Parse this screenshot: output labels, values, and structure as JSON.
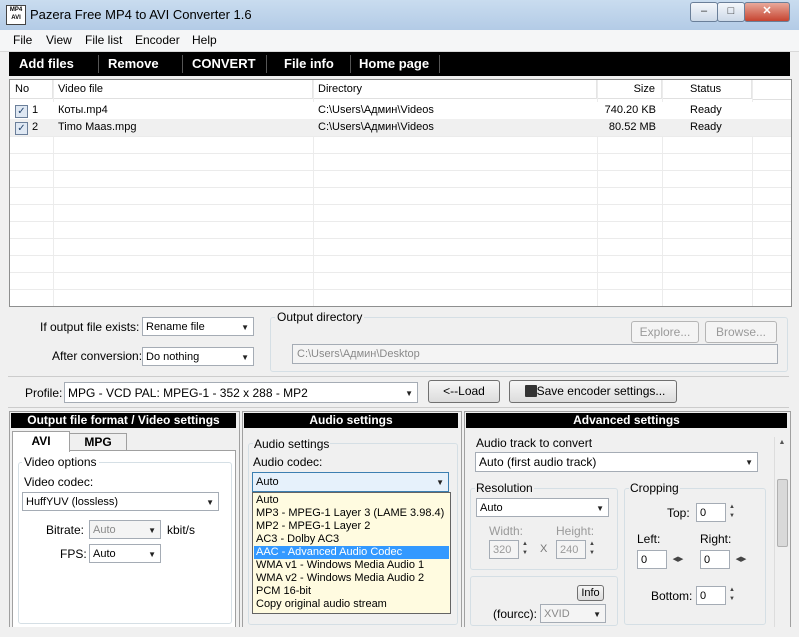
{
  "window": {
    "title": "Pazera Free MP4 to AVI Converter 1.6",
    "icon_text": "MP4 AVI",
    "controls": {
      "minimize": "–",
      "maximize": "□",
      "close": "✕"
    }
  },
  "menu": [
    "File",
    "View",
    "File list",
    "Encoder",
    "Help"
  ],
  "toolbar": [
    "Add files",
    "Remove",
    "CONVERT",
    "File info",
    "Home page"
  ],
  "file_table": {
    "columns": [
      "No",
      "Video file",
      "Directory",
      "Size",
      "Status"
    ],
    "rows": [
      {
        "checked": true,
        "no": "1",
        "file": "Коты.mp4",
        "dir": "C:\\Users\\Админ\\Videos",
        "size": "740.20 KB",
        "status": "Ready"
      },
      {
        "checked": true,
        "no": "2",
        "file": "Timo Maas.mpg",
        "dir": "C:\\Users\\Админ\\Videos",
        "size": "80.52 MB",
        "status": "Ready"
      }
    ]
  },
  "output": {
    "if_exists_label": "If output file exists:",
    "if_exists_value": "Rename file",
    "after_label": "After conversion:",
    "after_value": "Do nothing",
    "dir_group": "Output directory",
    "dir_value": "C:\\Users\\Админ\\Desktop",
    "explore": "Explore...",
    "browse": "Browse..."
  },
  "profile": {
    "label": "Profile:",
    "value": "MPG - VCD PAL: MPEG-1 - 352 x 288 - MP2",
    "load": "<--Load",
    "save": "Save encoder settings..."
  },
  "video_panel": {
    "header": "Output file format / Video settings",
    "tabs": [
      "AVI",
      "MPG"
    ],
    "group": "Video options",
    "codec_label": "Video codec:",
    "codec_value": "HuffYUV (lossless)",
    "bitrate_label": "Bitrate:",
    "bitrate_value": "Auto",
    "bitrate_unit": "kbit/s",
    "fps_label": "FPS:",
    "fps_value": "Auto"
  },
  "audio_panel": {
    "header": "Audio settings",
    "group": "Audio settings",
    "codec_label": "Audio codec:",
    "codec_value": "Auto",
    "options": [
      "Auto",
      "MP3 - MPEG-1 Layer 3 (LAME 3.98.4)",
      "MP2 - MPEG-1 Layer 2",
      "AC3 - Dolby AC3",
      "AAC - Advanced Audio Codec",
      "WMA v1 - Windows Media Audio 1",
      "WMA v2 - Windows Media Audio 2",
      "PCM 16-bit",
      "Copy original audio stream"
    ],
    "highlighted_index": 4
  },
  "advanced_panel": {
    "header": "Advanced settings",
    "track_label": "Audio track to convert",
    "track_value": "Auto (first audio track)",
    "resolution_group": "Resolution",
    "resolution_value": "Auto",
    "width_label": "Width:",
    "width_value": "320",
    "height_label": "Height:",
    "height_value": "240",
    "x_sep": "X",
    "cropping_group": "Cropping",
    "top_label": "Top:",
    "top_value": "0",
    "left_label": "Left:",
    "left_value": "0",
    "right_label": "Right:",
    "right_value": "0",
    "bottom_label": "Bottom:",
    "bottom_value": "0",
    "info_button": "Info",
    "fourcc_label": "(fourcc):",
    "fourcc_value": "XVID"
  },
  "colors": {
    "toolbar_bg": "#000000",
    "selection": "#3399ff",
    "dropdown_bg": "#fffbe0"
  }
}
